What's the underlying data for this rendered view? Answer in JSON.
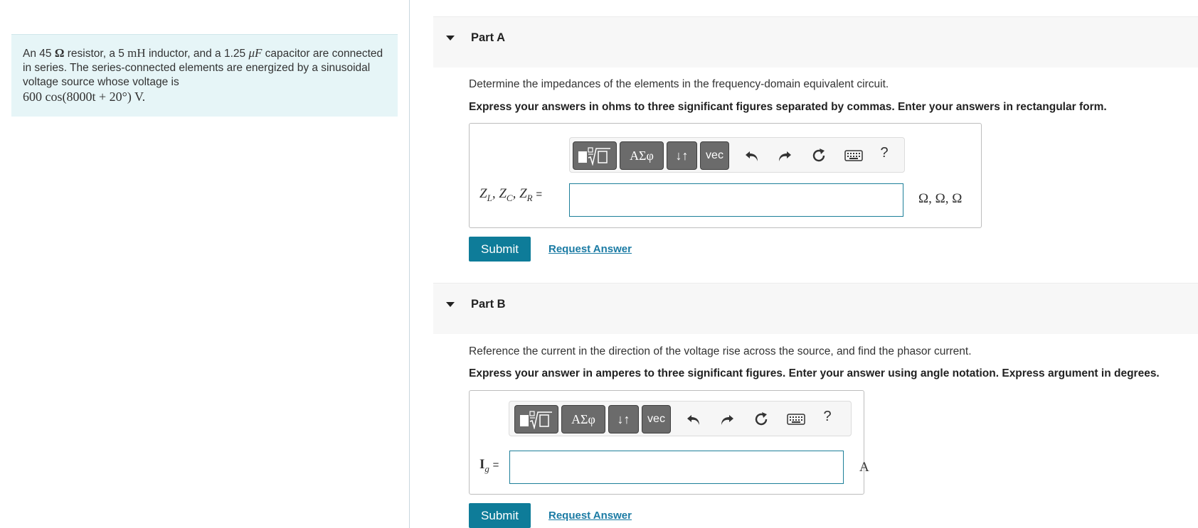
{
  "problem": {
    "text_1": "An 45 ",
    "resistance_unit": "Ω",
    "text_2": " resistor, a 5 ",
    "inductance_unit": "mH",
    "text_3": " inductor, and a 1.25 ",
    "capacitance_unit": "μF",
    "text_4": " capacitor are connected in series. The series-connected elements are energized by a sinusoidal voltage source whose voltage is ",
    "voltage_expr": "600 cos(8000t + 20°) V."
  },
  "partA": {
    "title": "Part A",
    "question": "Determine the impedances of the elements in the frequency-domain equivalent circuit.",
    "instruction": "Express your answers in ohms to three significant figures separated by commas. Enter your answers in rectangular form.",
    "label": "Z_L, Z_C, Z_R",
    "label_parts": [
      "Z",
      "L",
      "Z",
      "C",
      "Z",
      "R"
    ],
    "equals": "=",
    "input_value": "",
    "units": "Ω, Ω, Ω",
    "submit_label": "Submit",
    "request_label": "Request Answer"
  },
  "partB": {
    "title": "Part B",
    "question": "Reference the current in the direction of the voltage rise across the source, and find the phasor current.",
    "instruction": "Express your answer in amperes to three significant figures. Enter your answer using angle notation. Express argument in degrees.",
    "label_main": "I",
    "label_sub": "g",
    "equals": "=",
    "input_value": "",
    "units": "A",
    "submit_label": "Submit",
    "request_label": "Request Answer"
  },
  "toolbar": {
    "templates_icon": "templates-icon",
    "greek_label": "ΑΣφ",
    "arrows_label": "↓↑",
    "vec_label": "vec",
    "undo_icon": "undo-icon",
    "redo_icon": "redo-icon",
    "reset_icon": "reset-icon",
    "keyboard_icon": "keyboard-icon",
    "help_label": "?"
  }
}
